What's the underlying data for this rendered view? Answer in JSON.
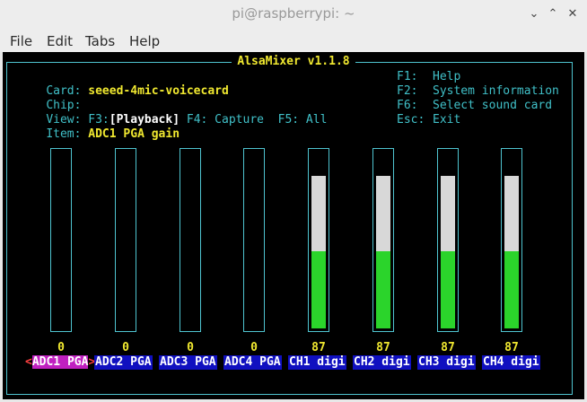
{
  "window": {
    "title": "pi@raspberrypi: ~",
    "minimize": "⌄",
    "maximize": "⌃",
    "close": "✕"
  },
  "menu": [
    "File",
    "Edit",
    "Tabs",
    "Help"
  ],
  "mixer": {
    "title": "AlsaMixer v1.1.8",
    "card_label": "Card:",
    "card_value": "seeed-4mic-voicecard",
    "chip_label": "Chip:",
    "view_label": "View:",
    "view_f3": "F3:",
    "view_playback": "[Playback]",
    "view_f4": "F4: Capture",
    "view_f5": "F5: All",
    "item_label": "Item:",
    "item_value": "ADC1 PGA gain",
    "help": [
      {
        "key": "F1:",
        "text": "Help"
      },
      {
        "key": "F2:",
        "text": "System information"
      },
      {
        "key": "F6:",
        "text": "Select sound card"
      },
      {
        "key": "Esc:",
        "text": "Exit"
      }
    ],
    "channels": [
      {
        "name": "ADC1 PGA",
        "value": "0",
        "level": 0,
        "selected": true
      },
      {
        "name": "ADC2 PGA",
        "value": "0",
        "level": 0
      },
      {
        "name": "ADC3 PGA",
        "value": "0",
        "level": 0
      },
      {
        "name": "ADC4 PGA",
        "value": "0",
        "level": 0
      },
      {
        "name": "CH1 digi",
        "value": "87",
        "level": 87
      },
      {
        "name": "CH2 digi",
        "value": "87",
        "level": 87
      },
      {
        "name": "CH3 digi",
        "value": "87",
        "level": 87
      },
      {
        "name": "CH4 digi",
        "value": "87",
        "level": 87
      }
    ],
    "sel_left": "<",
    "sel_right": ">"
  }
}
